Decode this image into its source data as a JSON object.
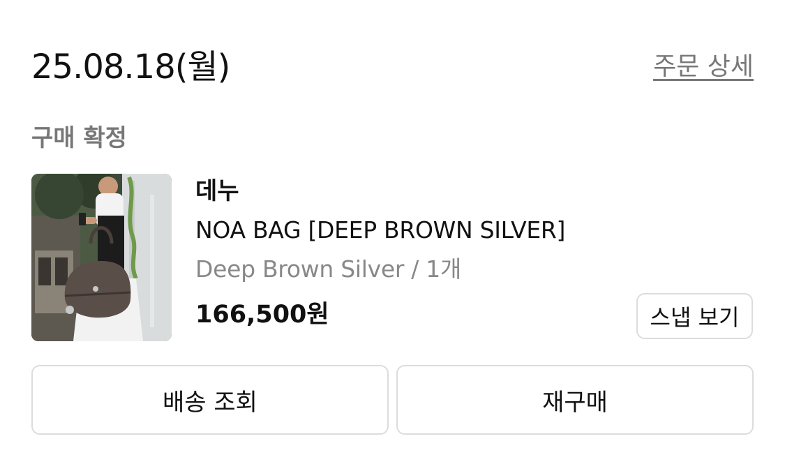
{
  "order": {
    "date": "25.08.18(월)",
    "detail_link": "주문 상세",
    "status": "구매 확정"
  },
  "item": {
    "image_icon": "product-photo",
    "brand": "데누",
    "name": "NOA BAG [DEEP BROWN SILVER]",
    "option": "Deep Brown Silver / 1개",
    "price": "166,500원",
    "snap_button": "스냅 보기"
  },
  "actions": {
    "track_delivery": "배송 조회",
    "rebuy": "재구매"
  }
}
